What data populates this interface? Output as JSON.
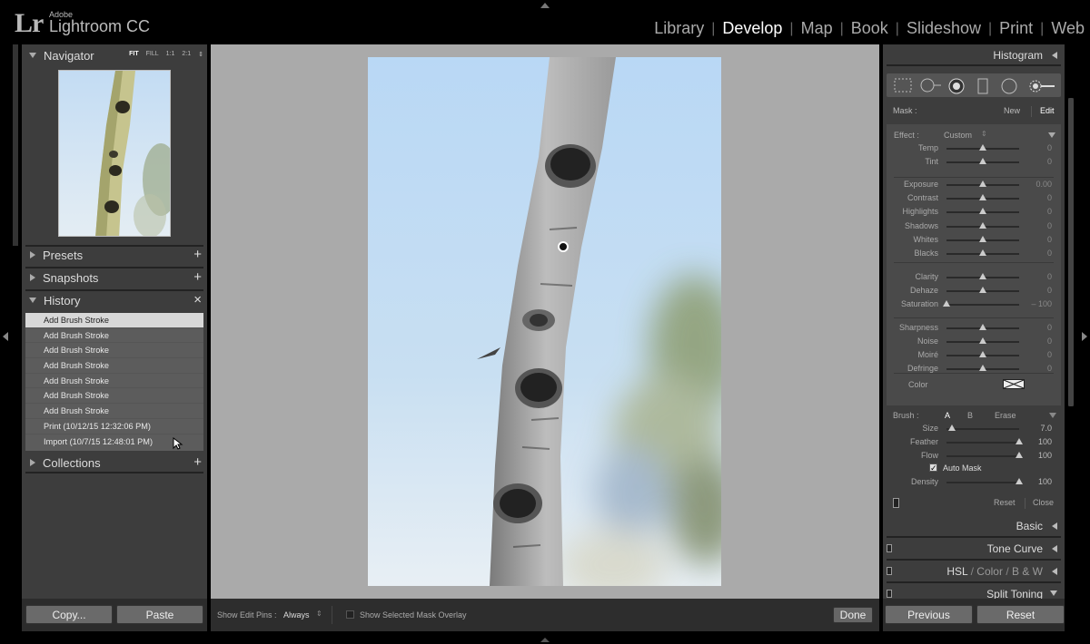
{
  "app": {
    "logo": "Lr",
    "vendor": "Adobe",
    "product": "Lightroom CC"
  },
  "modules": [
    {
      "label": "Library",
      "active": false
    },
    {
      "label": "Develop",
      "active": true
    },
    {
      "label": "Map",
      "active": false
    },
    {
      "label": "Book",
      "active": false
    },
    {
      "label": "Slideshow",
      "active": false
    },
    {
      "label": "Print",
      "active": false
    },
    {
      "label": "Web",
      "active": false
    }
  ],
  "left": {
    "navigator": {
      "title": "Navigator",
      "options": [
        "FIT",
        "FILL",
        "1:1",
        "2:1"
      ],
      "selected": "FIT"
    },
    "presets": {
      "title": "Presets",
      "action": "+"
    },
    "snapshots": {
      "title": "Snapshots",
      "action": "+"
    },
    "history": {
      "title": "History",
      "action": "×",
      "items": [
        "Add Brush Stroke",
        "Add Brush Stroke",
        "Add Brush Stroke",
        "Add Brush Stroke",
        "Add Brush Stroke",
        "Add Brush Stroke",
        "Add Brush Stroke",
        "Print (10/12/15 12:32:06 PM)",
        "Import (10/7/15 12:48:01 PM)"
      ],
      "selected_index": 0
    },
    "collections": {
      "title": "Collections",
      "action": "+"
    },
    "buttons": {
      "copy": "Copy...",
      "paste": "Paste"
    }
  },
  "toolbar": {
    "show_edit_pins_label": "Show Edit Pins :",
    "show_edit_pins_value": "Always",
    "mask_overlay_label": "Show Selected Mask Overlay",
    "mask_overlay_checked": false,
    "done": "Done"
  },
  "right": {
    "histogram": "Histogram",
    "mask": {
      "label": "Mask :",
      "new": "New",
      "edit": "Edit"
    },
    "effect": {
      "label": "Effect :",
      "value": "Custom"
    },
    "sliders": [
      {
        "label": "Temp",
        "value": "0",
        "pos": 0.5
      },
      {
        "label": "Tint",
        "value": "0",
        "pos": 0.5
      },
      {
        "label": "Exposure",
        "value": "0.00",
        "pos": 0.5
      },
      {
        "label": "Contrast",
        "value": "0",
        "pos": 0.5
      },
      {
        "label": "Highlights",
        "value": "0",
        "pos": 0.5
      },
      {
        "label": "Shadows",
        "value": "0",
        "pos": 0.5
      },
      {
        "label": "Whites",
        "value": "0",
        "pos": 0.5
      },
      {
        "label": "Blacks",
        "value": "0",
        "pos": 0.5
      },
      {
        "label": "Clarity",
        "value": "0",
        "pos": 0.5
      },
      {
        "label": "Dehaze",
        "value": "0",
        "pos": 0.5
      },
      {
        "label": "Saturation",
        "value": "– 100",
        "pos": 0.0
      },
      {
        "label": "Sharpness",
        "value": "0",
        "pos": 0.5
      },
      {
        "label": "Noise",
        "value": "0",
        "pos": 0.5
      },
      {
        "label": "Moiré",
        "value": "0",
        "pos": 0.5
      },
      {
        "label": "Defringe",
        "value": "0",
        "pos": 0.5
      }
    ],
    "color_label": "Color",
    "brush": {
      "label": "Brush :",
      "tabs": [
        "A",
        "B",
        "Erase"
      ],
      "size": {
        "label": "Size",
        "value": "7.0",
        "pos": 0.08
      },
      "feather": {
        "label": "Feather",
        "value": "100",
        "pos": 1.0
      },
      "flow": {
        "label": "Flow",
        "value": "100",
        "pos": 1.0
      },
      "auto_mask": {
        "label": "Auto Mask",
        "checked": true
      },
      "density": {
        "label": "Density",
        "value": "100",
        "pos": 1.0
      },
      "reset": "Reset",
      "close": "Close"
    },
    "panels": {
      "basic": "Basic",
      "tone_curve": "Tone Curve",
      "hsl": "HSL",
      "color": "Color",
      "bw": "B & W",
      "split_toning": "Split Toning"
    },
    "buttons": {
      "previous": "Previous",
      "reset": "Reset"
    }
  }
}
